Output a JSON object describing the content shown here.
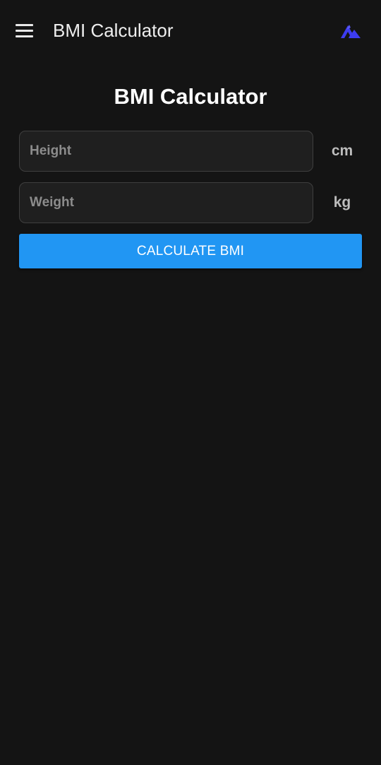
{
  "app_bar": {
    "title": "BMI Calculator",
    "menu_icon": "hamburger-menu-icon",
    "logo_icon": "mountain-logo-icon"
  },
  "main": {
    "heading": "BMI Calculator",
    "height_field": {
      "placeholder": "Height",
      "value": "",
      "unit": "cm"
    },
    "weight_field": {
      "placeholder": "Weight",
      "value": "",
      "unit": "kg"
    },
    "calculate_button": {
      "label": "CALCULATE BMI"
    }
  },
  "colors": {
    "background": "#141414",
    "accent": "#2196f3",
    "logo": "#3d3cf0",
    "input_background": "#1f1f1f",
    "input_border": "#3f3f3f"
  }
}
